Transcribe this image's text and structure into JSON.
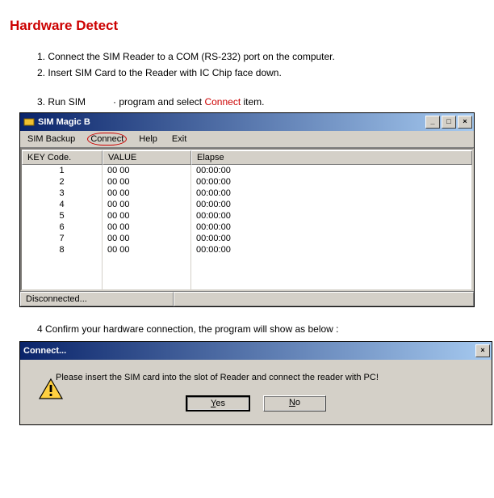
{
  "title": "Hardware Detect",
  "steps": {
    "s1": "1. Connect the SIM Reader to a COM (RS-232) port on the computer.",
    "s2": "2. Insert SIM Card to the Reader with IC Chip face down.",
    "s3_a": "3. Run SIM",
    "s3_b": "program and select",
    "s3_connect": "Connect",
    "s3_c": "item.",
    "s4": "4 Confirm your hardware connection, the program will show as below :"
  },
  "window": {
    "title": "SIM Magic B",
    "menus": {
      "backup": "SIM Backup",
      "connect": "Connect",
      "help": "Help",
      "exit": "Exit"
    },
    "headers": {
      "key": "KEY Code.",
      "value": "VALUE",
      "elapse": "Elapse"
    },
    "rows": [
      {
        "key": "1",
        "value": "00 00",
        "elapse": "00:00:00"
      },
      {
        "key": "2",
        "value": "00 00",
        "elapse": "00:00:00"
      },
      {
        "key": "3",
        "value": "00 00",
        "elapse": "00:00:00"
      },
      {
        "key": "4",
        "value": "00 00",
        "elapse": "00:00:00"
      },
      {
        "key": "5",
        "value": "00 00",
        "elapse": "00:00:00"
      },
      {
        "key": "6",
        "value": "00 00",
        "elapse": "00:00:00"
      },
      {
        "key": "7",
        "value": "00 00",
        "elapse": "00:00:00"
      },
      {
        "key": "8",
        "value": "00 00",
        "elapse": "00:00:00"
      }
    ],
    "status": "Disconnected..."
  },
  "dialog": {
    "title": "Connect...",
    "message": "Please insert the SIM card into the slot of Reader and connect the reader with PC!",
    "yes": "Yes",
    "no": "No"
  }
}
